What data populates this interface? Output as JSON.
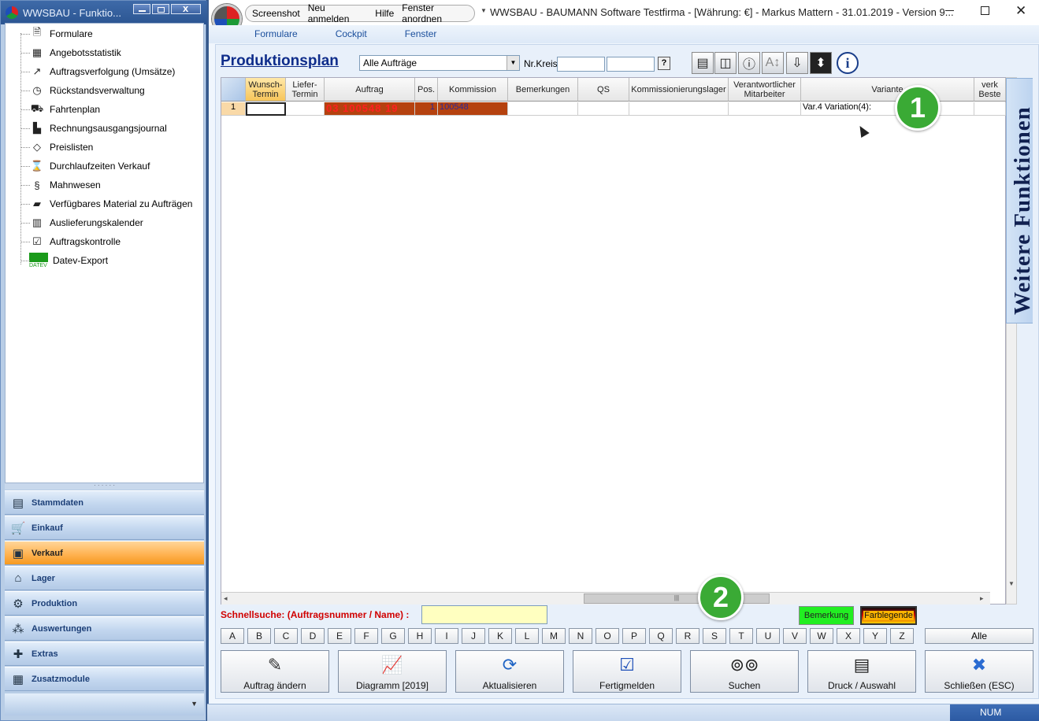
{
  "left_window": {
    "title": "WWSBAU - Funktio...",
    "tree_items": [
      {
        "label": "Formulare",
        "icon": "form-icon"
      },
      {
        "label": "Angebotsstatistik",
        "icon": "chart-icon"
      },
      {
        "label": "Auftragsverfolgung (Umsätze)",
        "icon": "trend-icon"
      },
      {
        "label": "Rückstandsverwaltung",
        "icon": "clock-icon"
      },
      {
        "label": "Fahrtenplan",
        "icon": "truck-icon"
      },
      {
        "label": "Rechnungsausgangsjournal",
        "icon": "journal-icon"
      },
      {
        "label": "Preislisten",
        "icon": "tag-icon"
      },
      {
        "label": "Durchlaufzeiten Verkauf",
        "icon": "hourglass-icon"
      },
      {
        "label": "Mahnwesen",
        "icon": "dunning-icon"
      },
      {
        "label": "Verfügbares Material zu Aufträgen",
        "icon": "material-icon"
      },
      {
        "label": "Auslieferungskalender",
        "icon": "calendar-icon"
      },
      {
        "label": "Auftragskontrolle",
        "icon": "checklist-icon"
      },
      {
        "label": "Datev-Export",
        "icon": "datev-icon",
        "icon_text": "DATEV"
      }
    ],
    "nav_items": [
      {
        "label": "Stammdaten",
        "icon": "stammdaten-icon"
      },
      {
        "label": "Einkauf",
        "icon": "cart-icon"
      },
      {
        "label": "Verkauf",
        "icon": "register-icon",
        "active": true
      },
      {
        "label": "Lager",
        "icon": "warehouse-icon"
      },
      {
        "label": "Produktion",
        "icon": "production-icon"
      },
      {
        "label": "Auswertungen",
        "icon": "analysis-icon"
      },
      {
        "label": "Extras",
        "icon": "extras-icon"
      },
      {
        "label": "Zusatzmodule",
        "icon": "modules-icon"
      }
    ]
  },
  "main_window": {
    "quickbar": [
      "Screenshot",
      "Neu anmelden",
      "Hilfe",
      "Fenster anordnen"
    ],
    "title": "WWSBAU - BAUMANN Software Testfirma - [Währung: €] -   Markus Mattern - 31.01.2019 - Version 9...",
    "menu": [
      "Formulare",
      "Cockpit",
      "Fenster"
    ]
  },
  "content": {
    "page_title": "Produktionsplan",
    "filter_value": "Alle Aufträge",
    "nrkreis_label": "Nr.Kreis",
    "help_label": "?",
    "columns": [
      "",
      "Wunsch-\nTermin",
      "Liefer-\nTermin",
      "Auftrag",
      "Pos.",
      "Kommission",
      "Bemerkungen",
      "QS",
      "Kommissionierungslager",
      "Verantwortlicher\nMitarbeiter",
      "Variante",
      "verk\nBeste"
    ],
    "row": {
      "num": "1",
      "wunsch": "",
      "liefer": "",
      "auftrag": "03 100548 19",
      "pos": "1",
      "kommission": "100548",
      "bemerkungen": "",
      "qs": "",
      "lager": "",
      "mitarbeiter": "",
      "variante": "Var.4 Variation(4):",
      "verk": ""
    },
    "side_panel": "Weitere Funktionen",
    "badges": [
      "1",
      "2"
    ],
    "quicksearch_label": "Schnellsuche: (Auftragsnummer / Name) :",
    "quicksearch_value": "",
    "bemerkung_label": "Bemerkung",
    "farblegende_label": "Farblegende",
    "letters": [
      "A",
      "B",
      "C",
      "D",
      "E",
      "F",
      "G",
      "H",
      "I",
      "J",
      "K",
      "L",
      "M",
      "N",
      "O",
      "P",
      "Q",
      "R",
      "S",
      "T",
      "U",
      "V",
      "W",
      "X",
      "Y",
      "Z"
    ],
    "alle_label": "Alle",
    "actions": [
      {
        "label": "Auftrag ändern",
        "icon": "edit-icon"
      },
      {
        "label": "Diagramm [2019]",
        "icon": "diagram-icon"
      },
      {
        "label": "Aktualisieren",
        "icon": "refresh-icon"
      },
      {
        "label": "Fertigmelden",
        "icon": "done-icon"
      },
      {
        "label": "Suchen",
        "icon": "binoculars-icon"
      },
      {
        "label": "Druck / Auswahl",
        "icon": "printer-icon"
      },
      {
        "label": "Schließen (ESC)",
        "icon": "close-icon"
      }
    ]
  },
  "status": {
    "num": "NUM"
  },
  "colors": {
    "accent": "#0f2d8b",
    "active_nav": "#ffb04d",
    "order_bg": "#b5420f",
    "order_text": "#ff2020"
  }
}
